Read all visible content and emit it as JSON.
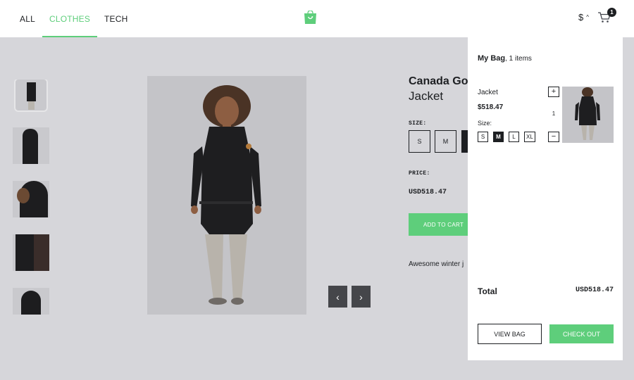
{
  "nav": {
    "items": [
      {
        "label": "ALL",
        "active": false
      },
      {
        "label": "CLOTHES",
        "active": true
      },
      {
        "label": "TECH",
        "active": false
      }
    ]
  },
  "header": {
    "logo_icon": "shopping-bag-icon",
    "currency_symbol": "$",
    "currency_chevron": "^",
    "cart_count": "1",
    "accent_color": "#5ece7b"
  },
  "product": {
    "brand": "Canada Go",
    "name": "Jacket",
    "size_label": "SIZE:",
    "sizes": [
      "S",
      "M",
      ""
    ],
    "price_label": "PRICE:",
    "price": "USD518.47",
    "add_to_cart": "ADD TO CART",
    "description": "Awesome winter j",
    "prev_arrow": "‹",
    "next_arrow": "›"
  },
  "minicart": {
    "title": "My Bag",
    "count_text": ", 1 items",
    "item": {
      "name": "Jacket",
      "price": "$518.47",
      "size_label": "Size:",
      "sizes": [
        "S",
        "M",
        "L",
        "XL"
      ],
      "selected_size": "M",
      "plus": "+",
      "quantity": "1",
      "minus": "−"
    },
    "total_label": "Total",
    "total_value": "USD518.47",
    "view_bag": "VIEW BAG",
    "check_out": "CHECK OUT"
  }
}
